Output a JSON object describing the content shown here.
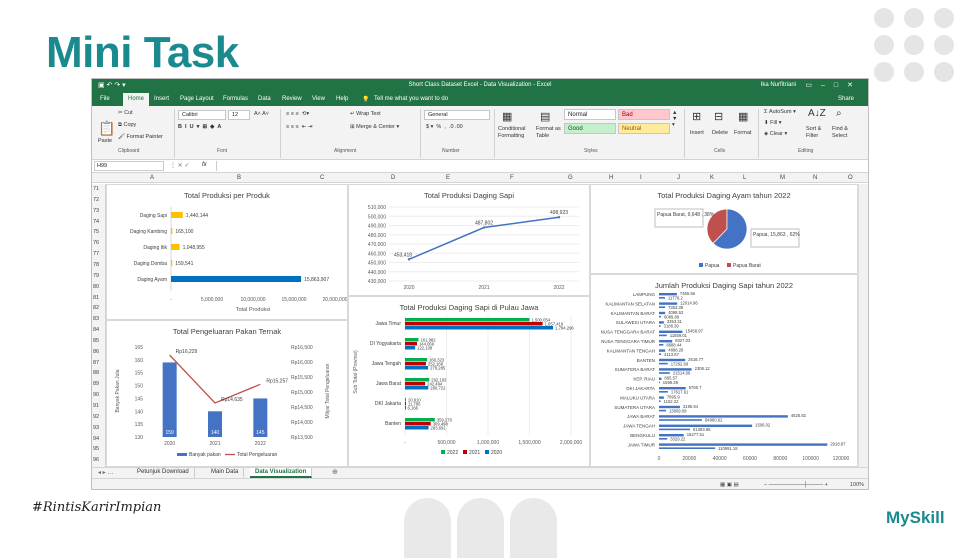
{
  "slide": {
    "title": "Mini Task",
    "hashtag": "#RintisKarirImpian",
    "brand": "MySkill"
  },
  "excel": {
    "window_title": "Short Class Dataset Excel - Data Visualization - Excel",
    "user": "Ika Nurfitriani",
    "menu": [
      "File",
      "Home",
      "Insert",
      "Page Layout",
      "Formulas",
      "Data",
      "Review",
      "View",
      "Help",
      "Tell me what you want to do",
      "Share"
    ],
    "ribbon": {
      "cut": "Cut",
      "copy": "Copy",
      "format_painter": "Format Painter",
      "paste": "Paste",
      "clipboard": "Clipboard",
      "font_name": "Calibri",
      "font_size": "12",
      "font": "Font",
      "alignment": "Alignment",
      "wrap_text": "Wrap Text",
      "merge_center": "Merge & Center",
      "number_format": "General",
      "number": "Number",
      "conditional": "Conditional Formatting",
      "format_table": "Format as Table",
      "style_normal": "Normal",
      "style_bad": "Bad",
      "style_good": "Good",
      "style_neutral": "Neutral",
      "styles": "Styles",
      "insert": "Insert",
      "delete": "Delete",
      "format": "Format",
      "cells": "Cells",
      "autosum": "AutoSum",
      "fill": "Fill",
      "clear": "Clear",
      "sort_filter": "Sort & Filter",
      "find_select": "Find & Select",
      "editing": "Editing"
    },
    "name_box": "H99",
    "fx": "fx",
    "columns": [
      "A",
      "B",
      "C",
      "D",
      "E",
      "F",
      "G",
      "H",
      "I",
      "J",
      "K",
      "L",
      "M",
      "N",
      "O"
    ],
    "rows": [
      "71",
      "72",
      "73",
      "74",
      "75",
      "76",
      "77",
      "78",
      "79",
      "80",
      "81",
      "82",
      "83",
      "84",
      "85",
      "86",
      "87",
      "88",
      "89",
      "90",
      "91",
      "92",
      "93",
      "94",
      "95",
      "96"
    ],
    "sheets": [
      "Petunjuk Download",
      "Main Data",
      "Data Visualization"
    ],
    "active_sheet": "Data Visualization",
    "zoom": "100%"
  },
  "chart_data": [
    {
      "type": "bar",
      "title": "Total Produksi per Produk",
      "orientation": "horizontal",
      "categories": [
        "Daging Sapi",
        "Daging Kambing",
        "Daging Itik",
        "Daging Domba",
        "Daging Ayam"
      ],
      "values": [
        1440144,
        165100,
        1048955,
        159541,
        15863907
      ],
      "value_labels": [
        "1,440,144",
        "165,100",
        "1,048,955",
        "159,541",
        "15,863,907"
      ],
      "xlabel": "Total Produksi",
      "xlim": [
        0,
        20000000
      ],
      "xticks": [
        "-",
        "5,000,000",
        "10,000,000",
        "15,000,000",
        "20,000,000"
      ],
      "colors": [
        "#ffc000",
        "#ffc000",
        "#ffc000",
        "#ffc000",
        "#0070c0"
      ]
    },
    {
      "type": "line",
      "title": "Total Produksi Daging Sapi",
      "categories": [
        "2020",
        "2021",
        "2022"
      ],
      "values": [
        453418,
        487802,
        498923
      ],
      "value_labels": [
        "453,418",
        "487,802",
        "498,923"
      ],
      "ylim": [
        430000,
        510000
      ],
      "yticks": [
        "430,000",
        "440,000",
        "450,000",
        "460,000",
        "470,000",
        "480,000",
        "490,000",
        "500,000",
        "510,000"
      ]
    },
    {
      "type": "pie",
      "title": "Total Produksi Daging Ayam tahun 2022",
      "categories": [
        "Papua",
        "Papua Barat"
      ],
      "values": [
        15863,
        9648
      ],
      "value_labels": [
        "Papua, 15,863 , 62%",
        "Papua Barat, 9,648 , 38%"
      ],
      "colors": [
        "#4472c4",
        "#c0504d"
      ]
    },
    {
      "type": "bar",
      "title": "Total Pengeluaran Pakan Ternak",
      "categories": [
        "2020",
        "2021",
        "2022"
      ],
      "values": [
        159,
        140,
        145
      ],
      "series": [
        {
          "name": "Banyak pakan",
          "values": [
            159,
            140,
            145
          ]
        },
        {
          "name": "Total Pengeluaran",
          "values": [
            16229,
            14635,
            15257
          ],
          "labels": [
            "Rp16,229",
            "Rp14,635",
            "Rp15,257"
          ]
        }
      ],
      "ylabel": "Banyak Pakan Juta",
      "y2label": "Milyar Total Pengeluaran",
      "ylim": [
        130,
        165
      ],
      "yticks": [
        "130",
        "135",
        "140",
        "145",
        "150",
        "155",
        "160",
        "165"
      ],
      "y2ticks": [
        "Rp13,500",
        "Rp14,000",
        "Rp14,500",
        "Rp15,000",
        "Rp15,500",
        "Rp16,000",
        "Rp16,500"
      ]
    },
    {
      "type": "bar",
      "title": "Total Produksi Daging Sapi di Pulau Jawa",
      "orientation": "horizontal",
      "categories": [
        "Jawa Timur",
        "DI Yogyakarta",
        "Jawa Tengah",
        "Jawa Barat",
        "DKI Jakarta",
        "Banten"
      ],
      "series": [
        {
          "name": "2022",
          "values": [
            1500054,
            161982,
            266323,
            292193,
            10910,
            359270
          ],
          "color": "#00b050"
        },
        {
          "name": "2021",
          "values": [
            1657419,
            144069,
            252168,
            242494,
            11785,
            309498
          ],
          "color": "#c00000"
        },
        {
          "name": "2020",
          "values": [
            1784296,
            122108,
            278285,
            280722,
            6166,
            283691
          ],
          "color": "#0070c0"
        }
      ],
      "ylabel": "Sub Total (Provinsi)",
      "xlim": [
        0,
        2000000
      ],
      "xticks": [
        "-",
        "500,000",
        "1,000,000",
        "1,500,000",
        "2,000,000"
      ]
    },
    {
      "type": "bar",
      "title": "Jumlah Produksi Daging Sapi tahun 2022",
      "orientation": "horizontal",
      "categories": [
        "LAMPUNG",
        "KALIMANTAN SELATAN",
        "KALIMANTAN BARAT",
        "SULAWESI UTARA",
        "NUSA TENGGARA BARAT",
        "NUSA TENGGARA TIMUR",
        "KALIMANTAN TENGAH",
        "BANTEN",
        "SUMATERA BARAT",
        "KEP. RIAU",
        "DKI JAKARTA",
        "MALUKU UTARA",
        "SUMATERA UTARA",
        "JAWA BARAT",
        "JAWA TENGAH",
        "BENGKULU",
        "JAWA TIMUR"
      ],
      "values": [
        11776.2,
        12014.96,
        4089.89,
        3188.39,
        15458.97,
        8688.44,
        4113.67,
        17262.69,
        21514.66,
        1598.39,
        17617.61,
        3195.94,
        13809.09,
        84960.62,
        61393.95,
        16277.51,
        110991.18
      ],
      "labels": [
        "7465.56",
        "11776.2",
        "12014.96",
        "7353.35",
        "4098.52",
        "6089.89",
        "3353.31",
        "3188.39",
        "15458.97",
        "11559.01",
        "9327.03",
        "8688.44",
        "4898.28",
        "4113.67",
        "2616.77",
        "17262.69",
        "2306.12",
        "21514.66",
        "895.57",
        "1598.39",
        "5760.7",
        "17617.61",
        "7895.9",
        "1152.22",
        "3195.94",
        "13809.09",
        "4525.82",
        "84960.62",
        "1506.02",
        "61393.95",
        "16277.51",
        "3329.22",
        "2918.87",
        "110991.18"
      ],
      "xlim": [
        0,
        120000
      ],
      "xticks": [
        "0",
        "20000",
        "40000",
        "60000",
        "80000",
        "100000",
        "120000"
      ],
      "color": "#4472c4"
    }
  ]
}
